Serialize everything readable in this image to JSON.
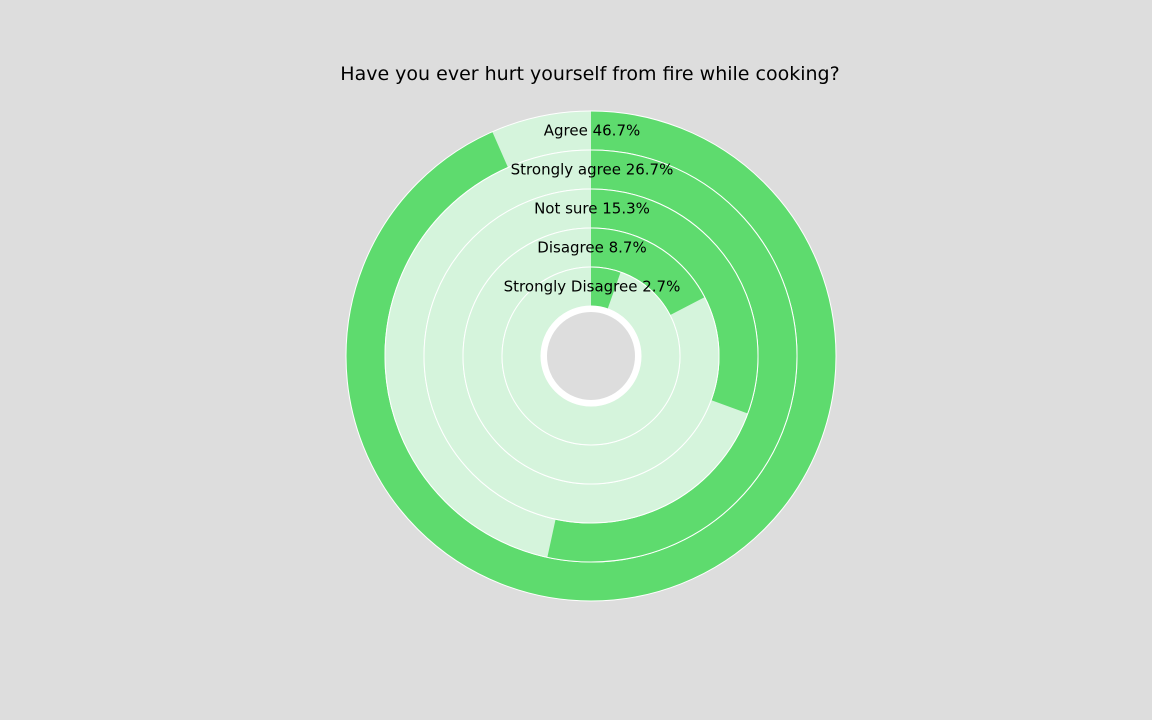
{
  "chart_data": {
    "type": "radial-bar",
    "title": "Have you ever hurt yourself from fire while cooking?",
    "series": [
      {
        "category": "Agree",
        "value": 46.7,
        "label": "Agree 46.7%"
      },
      {
        "category": "Strongly agree",
        "value": 26.7,
        "label": "Strongly agree 26.7%"
      },
      {
        "category": "Not sure",
        "value": 15.3,
        "label": "Not sure 15.3%"
      },
      {
        "category": "Disagree",
        "value": 8.7,
        "label": "Disagree 8.7%"
      },
      {
        "category": "Strongly Disagree",
        "value": 2.7,
        "label": "Strongly Disagree 2.7%"
      }
    ],
    "max_value": 50,
    "colors": {
      "bar": "#5edb6e",
      "track": "#d5f4dc",
      "ring_edge": "#ffffff",
      "background": "#dddddd"
    }
  }
}
